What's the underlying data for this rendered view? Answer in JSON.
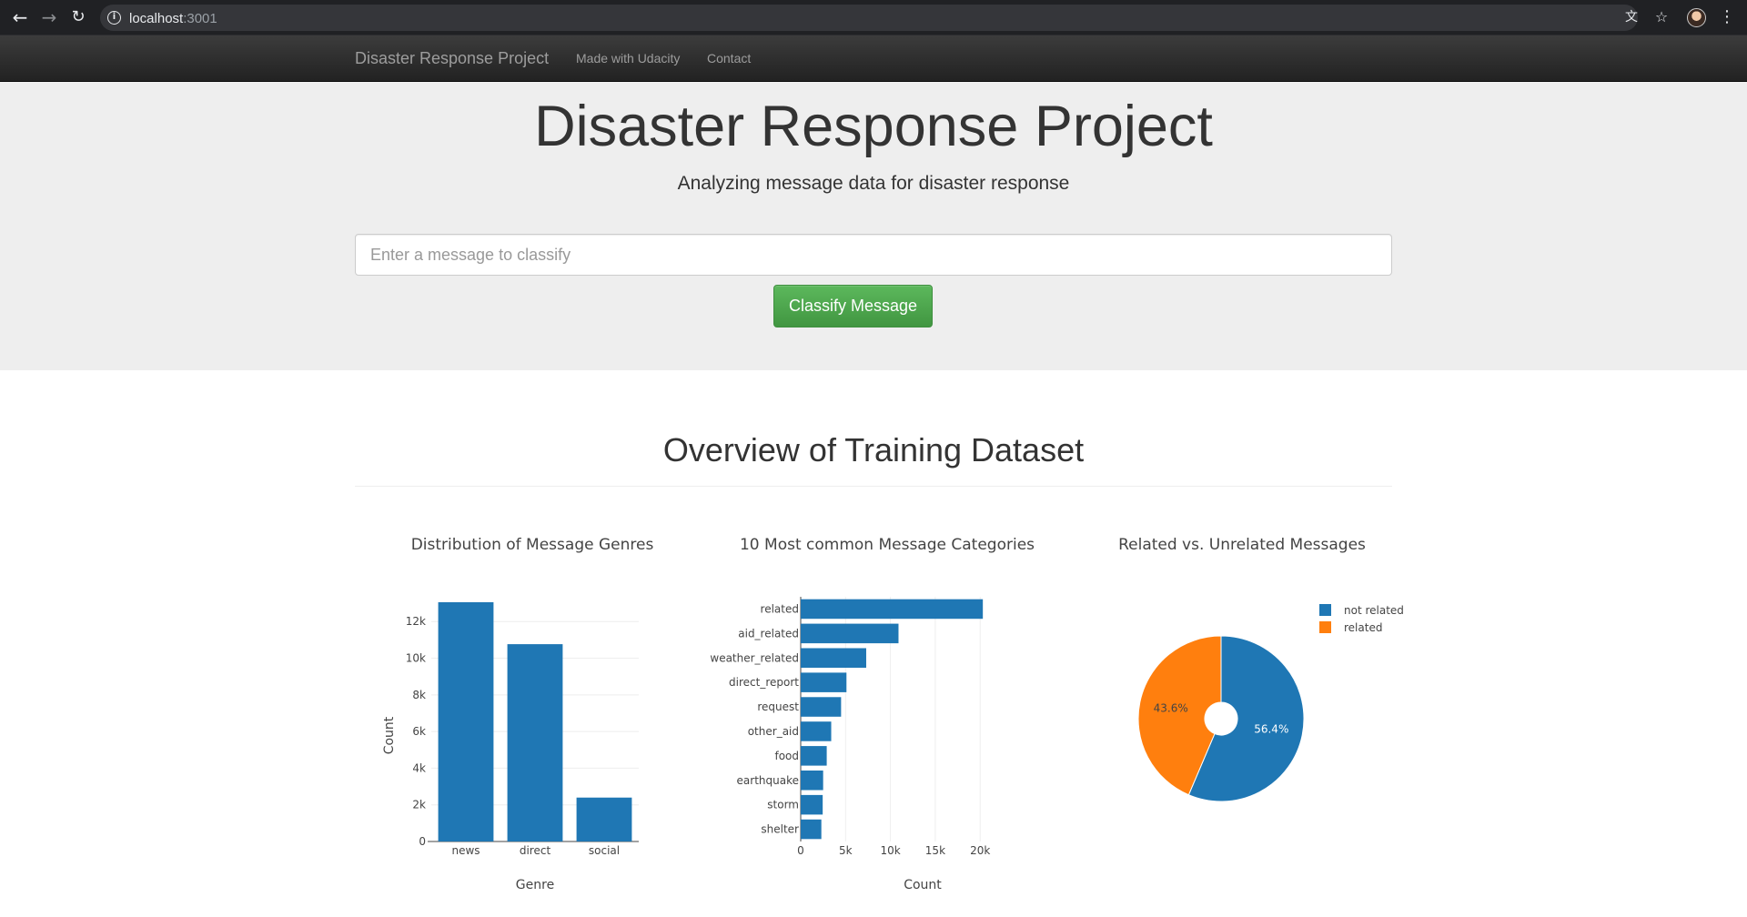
{
  "browser": {
    "url_host": "localhost",
    "url_port": ":3001",
    "back_icon": "arrow-left-icon",
    "forward_icon": "arrow-right-icon",
    "reload_icon": "reload-icon",
    "info_icon": "info-icon",
    "translate_icon": "translate-icon",
    "star_icon": "star-icon",
    "menu_icon": "kebab-menu-icon"
  },
  "navbar": {
    "brand": "Disaster Response Project",
    "links": [
      "Made with Udacity",
      "Contact"
    ]
  },
  "jumbotron": {
    "title": "Disaster Response Project",
    "subtitle": "Analyzing message data for disaster response",
    "input_placeholder": "Enter a message to classify",
    "button_label": "Classify Message"
  },
  "overview": {
    "title": "Overview of Training Dataset"
  },
  "colors": {
    "blue": "#1f77b4",
    "orange": "#ff7f0e",
    "button_green": "#5cb85c"
  },
  "chart_data": [
    {
      "type": "bar",
      "title": "Distribution of Message Genres",
      "xlabel": "Genre",
      "ylabel": "Count",
      "categories": [
        "news",
        "direct",
        "social"
      ],
      "values": [
        13054,
        10766,
        2396
      ],
      "ylim": [
        0,
        13054
      ],
      "yticks": [
        0,
        2000,
        4000,
        6000,
        8000,
        10000,
        12000
      ],
      "ytick_labels": [
        "0",
        "2k",
        "4k",
        "6k",
        "8k",
        "10k",
        "12k"
      ],
      "grid": true
    },
    {
      "type": "bar",
      "orientation": "horizontal",
      "title": "10 Most common Message Categories",
      "xlabel": "Count",
      "categories": [
        "related",
        "aid_related",
        "weather_related",
        "direct_report",
        "request",
        "other_aid",
        "food",
        "earthquake",
        "storm",
        "shelter"
      ],
      "values": [
        20300,
        10900,
        7300,
        5100,
        4500,
        3400,
        2900,
        2500,
        2450,
        2300
      ],
      "xlim": [
        0,
        21500
      ],
      "xticks": [
        0,
        5000,
        10000,
        15000,
        20000
      ],
      "xtick_labels": [
        "0",
        "5k",
        "10k",
        "15k",
        "20k"
      ],
      "grid": true
    },
    {
      "type": "pie",
      "title": "Related vs. Unrelated Messages",
      "labels": [
        "not related",
        "related"
      ],
      "values": [
        56.4,
        43.6
      ],
      "value_labels": [
        "56.4%",
        "43.6%"
      ],
      "hole": true,
      "legend": "top-right"
    }
  ]
}
